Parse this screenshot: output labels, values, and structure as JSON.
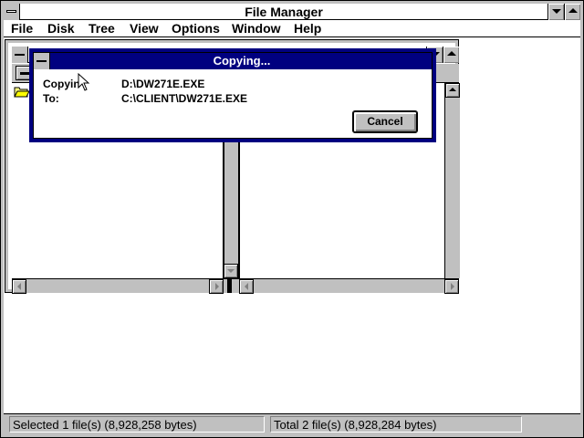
{
  "window": {
    "title": "File Manager"
  },
  "menu": {
    "items": [
      {
        "label": "File"
      },
      {
        "label": "Disk"
      },
      {
        "label": "Tree"
      },
      {
        "label": "View"
      },
      {
        "label": "Options"
      },
      {
        "label": "Window"
      },
      {
        "label": "Help"
      }
    ]
  },
  "dialog": {
    "title": "Copying...",
    "copying_label": "Copyin",
    "copying_value": "D:\\DW271E.EXE",
    "to_label": "To:",
    "to_value": "C:\\CLIENT\\DW271E.EXE",
    "cancel_label": "Cancel"
  },
  "status": {
    "selected": "Selected 1 file(s) (8,928,258 bytes)",
    "total": "Total 2 file(s) (8,928,284 bytes)"
  },
  "colors": {
    "dialog_title_bg": "#000080",
    "chrome_gray": "#c0c0c0"
  }
}
